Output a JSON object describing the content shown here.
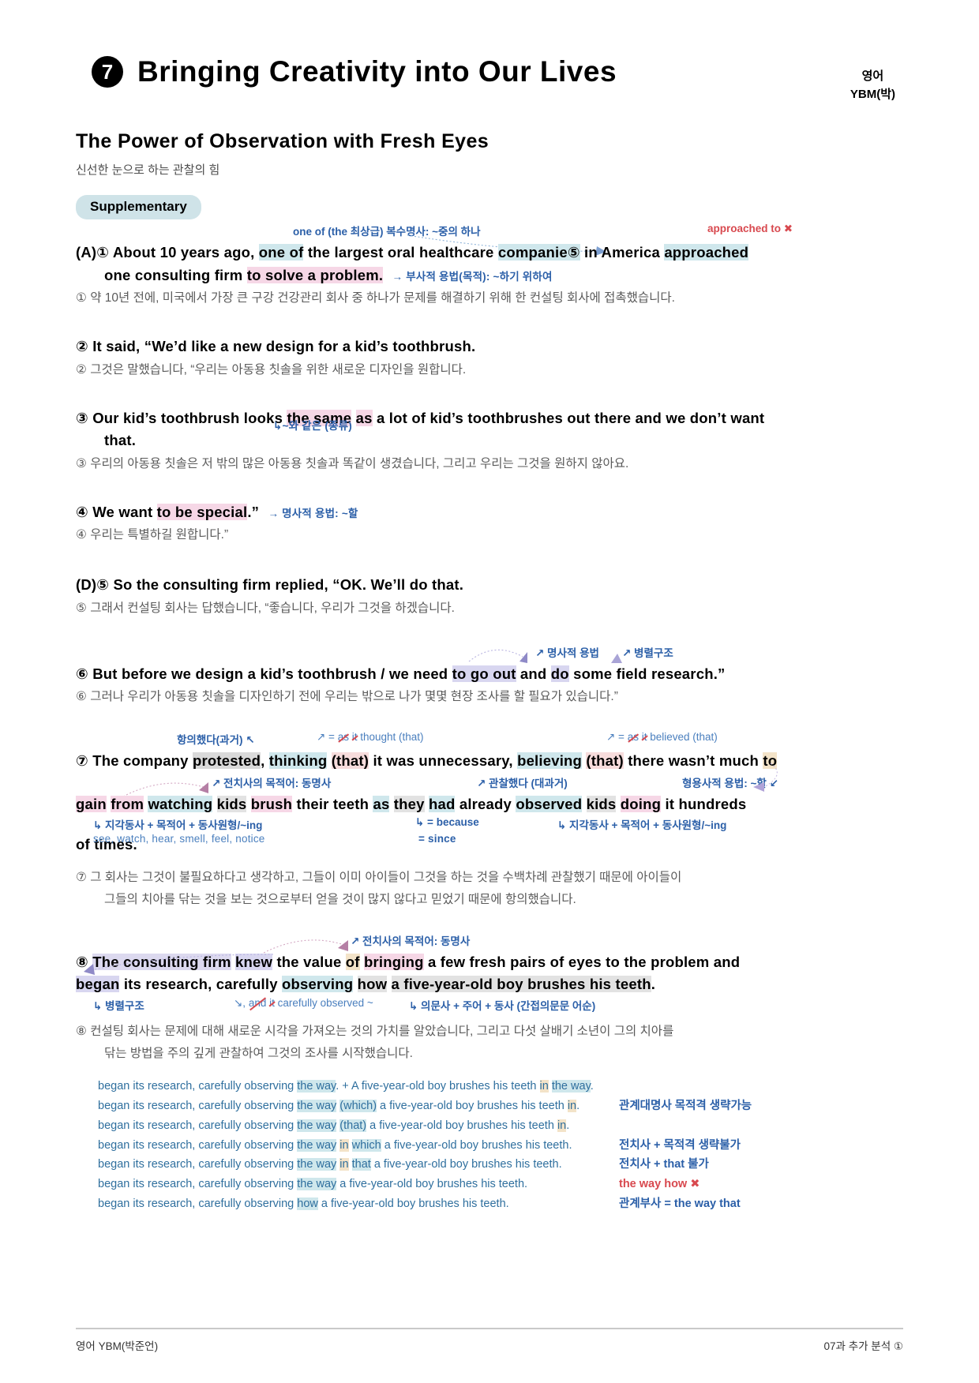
{
  "header": {
    "lesson_number": "7",
    "title": "Bringing Creativity into Our Lives",
    "subject": "영어",
    "publisher": "YBM(박)"
  },
  "section": {
    "title": "The Power of Observation with Fresh Eyes",
    "title_kr": "신선한 눈으로 하는 관찰의 힘",
    "badge": "Supplementary"
  },
  "colors": {
    "accent_blue": "#2b5fa8",
    "note_light_blue": "#4a7fbe",
    "error_red": "#d8494f",
    "hl_blue": "#cfe7ec",
    "hl_pink": "#f6d7e6",
    "hl_rose": "#f7dcdc",
    "hl_purple": "#d8d6f0",
    "hl_gray": "#d9d9d9",
    "hl_tan": "#f3e3c8",
    "badge_bg": "#cfe3e8"
  },
  "s1": {
    "label": "(A)①",
    "note_top": "one of (the 최상급) 복수명사: ~중의 하나",
    "note_right": "approached to ✖",
    "w1": "About 10 years ago,",
    "w2": "one of",
    "w3": "the largest oral healthcare",
    "w4": "companie⑤",
    "w5": "in America",
    "w6": "approached",
    "w7": "one consulting firm",
    "w8": "to solve a problem.",
    "note_line2": "→ 부사적 용법(목적): ~하기 위하여",
    "kr": "① 약 10년 전에, 미국에서 가장 큰 구강 건강관리 회사 중 하나가 문제를 해결하기 위해 한 컨설팅 회사에 접촉했습니다."
  },
  "s2": {
    "eng": "② It said, “We’d like a new design for a kid’s toothbrush.",
    "kr": "② 그것은 말했습니다, “우리는 아동용 칫솔을 위한 새로운 디자인을 원합니다."
  },
  "s3": {
    "label": "③",
    "w1": "Our kid’s toothbrush looks",
    "w2": "the same",
    "w3": "as",
    "w4": "a lot of kid’s toothbrushes out there and we don’t want",
    "w5": "that.",
    "note": "↳~와 같은 (종류)",
    "kr": "③ 우리의 아동용 칫솔은 저 밖의 많은 아동용 칫솔과 똑같이 생겼습니다, 그리고 우리는 그것을 원하지 않아요."
  },
  "s4": {
    "label": "④",
    "w1": "We want",
    "w2": "to be special",
    "w3": ".”",
    "note": "→ 명사적 용법: ~할",
    "kr": "④ 우리는 특별하길 원합니다.”"
  },
  "s5": {
    "eng": "(D)⑤ So the consulting firm replied, “OK. We’ll do that.",
    "kr": "⑤ 그래서 컨설팅 회사는 답했습니다, “좋습니다, 우리가 그것을 하겠습니다."
  },
  "s6": {
    "label": "⑥",
    "note_a": "↗ 명사적 용법",
    "note_b": "↗ 병렬구조",
    "w1": "But before we design a kid’s toothbrush / we need",
    "w2": "to go out",
    "w3": "and",
    "w4": "do",
    "w5": "some field research.”",
    "kr": "⑥ 그러나 우리가 아동용 칫솔을 디자인하기 전에 우리는 밖으로 나가 몇몇 현장 조사를 할 필요가 있습니다.”"
  },
  "s7": {
    "label": "⑦",
    "note_protested": "항의했다(과거) ↖",
    "note_thinking": "↗ = as it thought (that)",
    "note_believing": "↗ = as it believed (that)",
    "note_prep_obj1": "↗ 전치사의 목적어: 동명사",
    "note_observed": "↗ 관찰했다 (대과거)",
    "note_adj_usage": "형용사적 용법: ~할 ↙",
    "note_perception1": "↳ 지각동사 + 목적어 + 동사원형/~ing",
    "note_perception1_sub": "see, watch, hear, smell, feel, notice",
    "note_because": "↳ = because",
    "note_since": "= since",
    "note_perception2": "↳ 지각동사 + 목적어 + 동사원형/~ing",
    "l1_a": "The company",
    "l1_b": "protested",
    "l1_c": ",",
    "l1_d": "thinking",
    "l1_e": "(that)",
    "l1_f": "it was unnecessary,",
    "l1_g": "believing",
    "l1_h": "(that)",
    "l1_i": "there wasn’t much",
    "l1_j": "to",
    "l2_a": "gain",
    "l2_b": "from",
    "l2_c": "watching",
    "l2_d": "kids",
    "l2_e": "brush",
    "l2_f": "their teeth",
    "l2_g": "as",
    "l2_h": "they",
    "l2_i": "had",
    "l2_j": "already",
    "l2_k": "observed",
    "l2_l": "kids",
    "l2_m": "doing",
    "l2_n": "it hundreds",
    "l3": "of times.",
    "kr1": "⑦ 그 회사는 그것이 불필요하다고 생각하고, 그들이 이미 아이들이 그것을 하는 것을 수백차례 관찰했기 때문에 아이들이",
    "kr2": "그들의 치아를 닦는 것을 보는 것으로부터 얻을 것이 많지 않다고 믿었기 때문에 항의했습니다."
  },
  "s8": {
    "label": "⑧",
    "note_prep_obj": "↗ 전치사의 목적어: 동명사",
    "l1_a": "The consulting firm",
    "l1_b": "knew",
    "l1_c": "the value",
    "l1_d": "of",
    "l1_e": "bringing",
    "l1_f": "a few fresh pairs of eyes to the problem and",
    "l2_a": "began",
    "l2_b": "its research, carefully",
    "l2_c": "observing",
    "l2_d": "how",
    "l2_e": "a five-year-old boy brushes his teeth",
    "l2_f": ".",
    "note_parallel": "↳ 병렬구조",
    "note_and_it": "↘, and it carefully observed ~",
    "note_indirect": "↳ 의문사 + 주어 + 동사 (간접의문문 어순)",
    "kr1": "⑧ 컨설팅 회사는 문제에 대해 새로운 시각을 가져오는 것의 가치를 알았습니다, 그리고 다섯 살배기 소년이 그의 치아를",
    "kr2": "닦는 방법을 주의 깊게 관찰하여 그것의 조사를 시작했습니다."
  },
  "variants": {
    "prefix": "began its research, carefully observing",
    "rows": [
      {
        "parts": [
          {
            "t": "began its research, carefully observing ",
            "hl": ""
          },
          {
            "t": "the way",
            "hl": "blue"
          },
          {
            "t": ". + A five-year-old boy brushes his teeth ",
            "hl": ""
          },
          {
            "t": "in",
            "hl": "tan"
          },
          {
            "t": " ",
            "hl": ""
          },
          {
            "t": "the way",
            "hl": "blue"
          },
          {
            "t": ".",
            "hl": ""
          }
        ],
        "note": "",
        "note_red": false
      },
      {
        "parts": [
          {
            "t": "began its research, carefully observing ",
            "hl": ""
          },
          {
            "t": "the way",
            "hl": "blue"
          },
          {
            "t": " ",
            "hl": ""
          },
          {
            "t": "(which)",
            "hl": "blue"
          },
          {
            "t": " a five-year-old boy brushes his teeth ",
            "hl": ""
          },
          {
            "t": "in",
            "hl": "tan"
          },
          {
            "t": ".",
            "hl": ""
          }
        ],
        "note": "관계대명사 목적격 생략가능",
        "note_red": false
      },
      {
        "parts": [
          {
            "t": "began its research, carefully observing ",
            "hl": ""
          },
          {
            "t": "the way",
            "hl": "blue"
          },
          {
            "t": " ",
            "hl": ""
          },
          {
            "t": "(that)",
            "hl": "blue"
          },
          {
            "t": " a five-year-old boy brushes his teeth ",
            "hl": ""
          },
          {
            "t": "in",
            "hl": "tan"
          },
          {
            "t": ".",
            "hl": ""
          }
        ],
        "note": "",
        "note_red": false
      },
      {
        "parts": [
          {
            "t": "began its research, carefully observing ",
            "hl": ""
          },
          {
            "t": "the way",
            "hl": "blue"
          },
          {
            "t": " ",
            "hl": ""
          },
          {
            "t": "in",
            "hl": "tan"
          },
          {
            "t": " ",
            "hl": ""
          },
          {
            "t": "which",
            "hl": "blue"
          },
          {
            "t": " a five-year-old boy brushes his teeth.",
            "hl": ""
          }
        ],
        "note": "전치사 + 목적격 생략불가",
        "note_red": false
      },
      {
        "parts": [
          {
            "t": "began its research, carefully observing ",
            "hl": ""
          },
          {
            "t": "the way",
            "hl": "blue"
          },
          {
            "t": " ",
            "hl": ""
          },
          {
            "t": "in",
            "hl": "tan"
          },
          {
            "t": " ",
            "hl": ""
          },
          {
            "t": "that",
            "hl": "blue"
          },
          {
            "t": " a five-year-old boy brushes his teeth.",
            "hl": ""
          }
        ],
        "note": "전치사 + that 불가",
        "note_red": false
      },
      {
        "parts": [
          {
            "t": "began its research, carefully observing ",
            "hl": ""
          },
          {
            "t": "the way",
            "hl": "blue"
          },
          {
            "t": " a five-year-old boy brushes his teeth.",
            "hl": ""
          }
        ],
        "note": "the way how ✖",
        "note_red": true
      },
      {
        "parts": [
          {
            "t": "began its research, carefully observing ",
            "hl": ""
          },
          {
            "t": "how",
            "hl": "blue"
          },
          {
            "t": " a five-year-old boy brushes his teeth.",
            "hl": ""
          }
        ],
        "note": "관계부사 = the way that",
        "note_red": false
      }
    ]
  },
  "footer": {
    "left": "영어 YBM(박준언)",
    "right": "07과 추가 분석 ①"
  }
}
